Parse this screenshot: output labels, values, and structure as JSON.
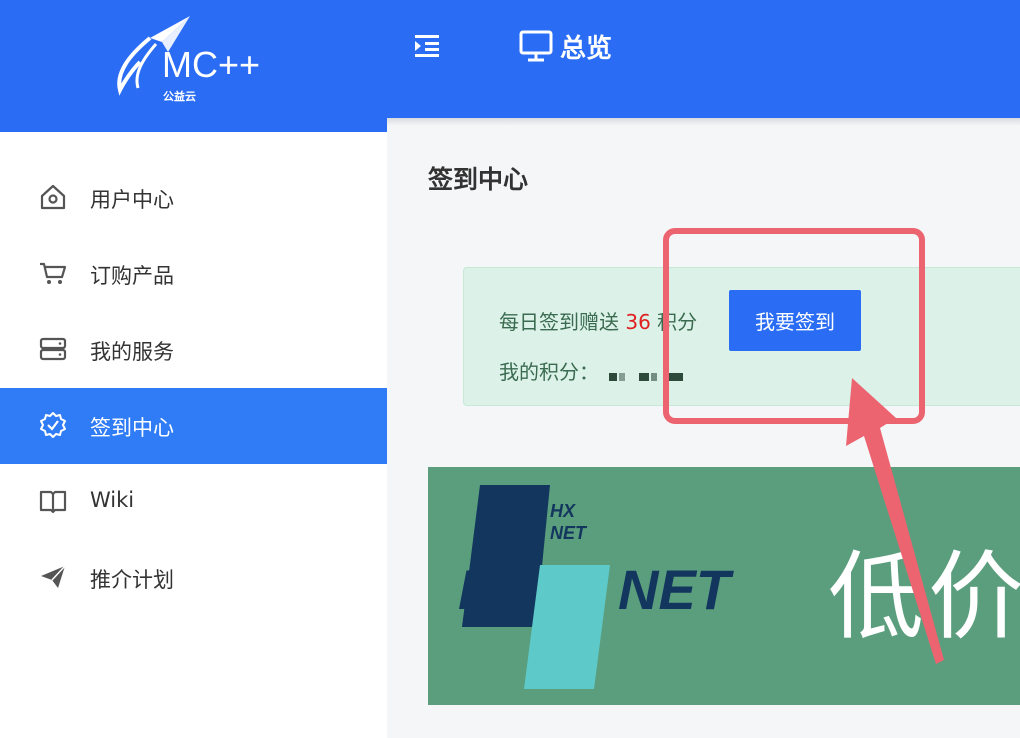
{
  "brand": {
    "name": "MC++",
    "subtitle": "公益云"
  },
  "header": {
    "title": "总览"
  },
  "sidebar": {
    "items": [
      {
        "label": "用户中心",
        "icon": "home-icon"
      },
      {
        "label": "订购产品",
        "icon": "cart-icon"
      },
      {
        "label": "我的服务",
        "icon": "server-icon"
      },
      {
        "label": "签到中心",
        "icon": "badge-check-icon",
        "active": true
      },
      {
        "label": "Wiki",
        "icon": "book-icon"
      },
      {
        "label": "推介计划",
        "icon": "paper-plane-icon"
      }
    ]
  },
  "main": {
    "section_title": "签到中心",
    "checkin": {
      "prefix": "每日签到赠送",
      "points": "36",
      "suffix": "积分",
      "button": "我要签到",
      "my_points_label": "我的积分："
    },
    "banner": {
      "logo_text": "HX NET",
      "logo_small": "HX NET",
      "text": "低价"
    }
  },
  "colors": {
    "primary": "#2a6df4",
    "active": "#2f7cf6",
    "alert_bg": "#dcf2e8",
    "highlight": "#ec6470",
    "banner_bg": "#5b9e7d"
  }
}
